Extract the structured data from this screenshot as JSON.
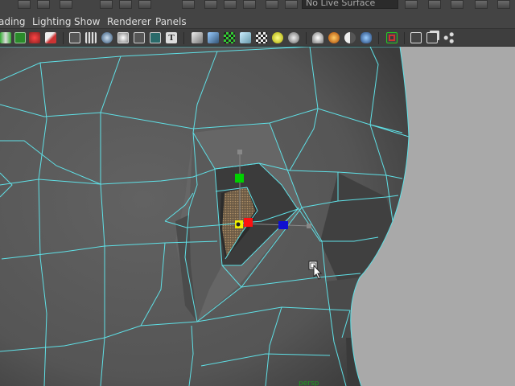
{
  "live_surface": {
    "value": "No Live Surface"
  },
  "menubar": {
    "items": [
      {
        "label": "ading"
      },
      {
        "label": "Lighting"
      },
      {
        "label": "Show"
      },
      {
        "label": "Renderer"
      },
      {
        "label": "Panels"
      }
    ]
  },
  "shelf": {
    "icons": [
      "select-icon",
      "lasso-icon",
      "paint-icon",
      "brush-icon",
      "wireframe-icon",
      "grid-icon",
      "sphere-icon",
      "smooth-icon",
      "xray-icon",
      "component-icon",
      "text-icon",
      "cube-icon",
      "cube-blue-icon",
      "isolate-icon",
      "cube-light-icon",
      "checker-icon",
      "light-yellow-icon",
      "sphere-grey-icon",
      "render-icon",
      "ipr-icon",
      "half-sphere-icon",
      "shader-icon",
      "camera-icon",
      "poly-cube-icon",
      "duplicate-icon",
      "share-icon"
    ]
  },
  "viewport": {
    "camera_label": "persp",
    "wire_color": "#5fe0e6",
    "mesh_color": "#5b5b5b",
    "background_color": "#a9a9a9"
  },
  "manipulator": {
    "y_handle_color": "#00d000",
    "x_handle_color": "#ff1010",
    "z_handle_color": "#1010d0",
    "center_color": "#f0f000"
  }
}
